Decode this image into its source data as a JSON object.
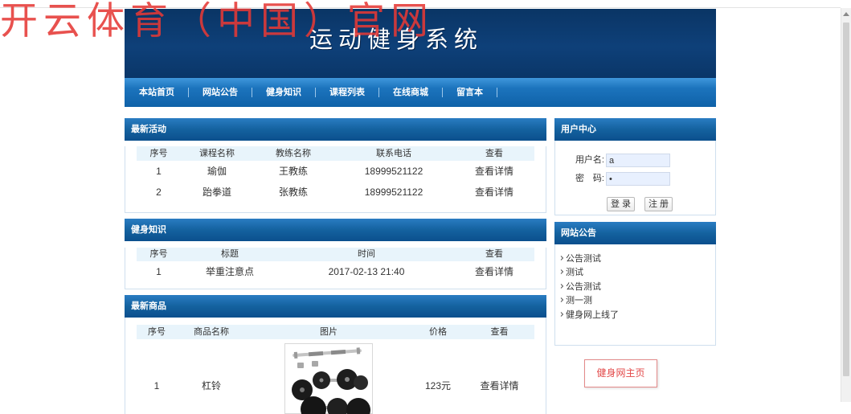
{
  "watermark": {
    "text": "开云体育（中国）官网"
  },
  "site": {
    "title": "运动健身系统"
  },
  "nav": [
    {
      "label": "本站首页"
    },
    {
      "label": "网站公告"
    },
    {
      "label": "健身知识"
    },
    {
      "label": "课程列表"
    },
    {
      "label": "在线商城"
    },
    {
      "label": "留言本"
    }
  ],
  "activities": {
    "title": "最新活动",
    "columns": [
      "序号",
      "课程名称",
      "教练名称",
      "联系电话",
      "查看"
    ],
    "rows": [
      [
        "1",
        "瑜伽",
        "王教练",
        "18999521122",
        "查看详情"
      ],
      [
        "2",
        "跆拳道",
        "张教练",
        "18999521122",
        "查看详情"
      ]
    ]
  },
  "knowledge": {
    "title": "健身知识",
    "columns": [
      "序号",
      "标题",
      "时间",
      "查看"
    ],
    "rows": [
      [
        "1",
        "举重注意点",
        "2017-02-13 21:40",
        "查看详情"
      ]
    ]
  },
  "products": {
    "title": "最新商品",
    "columns": [
      "序号",
      "商品名称",
      "图片",
      "价格",
      "查看"
    ],
    "rows": [
      {
        "no": "1",
        "name": "杠铃",
        "image": "barbell-product-image",
        "price": "123元",
        "link": "查看详情"
      }
    ]
  },
  "user_center": {
    "title": "用户中心",
    "username_label": "用户名:",
    "username_value": "a",
    "password_label": "密　码:",
    "password_value": "•",
    "login_label": "登 录",
    "register_label": "注 册"
  },
  "announcements": {
    "title": "网站公告",
    "items": [
      "公告测试",
      "测试",
      "公告测试",
      "测一测",
      "健身网上线了"
    ]
  },
  "home_link": {
    "label": "健身网主页"
  },
  "icons": {
    "announcement_bullet": "chevron-right-icon",
    "scroll_up": "scroll-up-arrow-icon"
  },
  "colors": {
    "header_bg": "#0c3a6f",
    "bar_blue": "#1a6db3",
    "table_head_bg": "#e8f4fb",
    "input_bg": "#e8f0fe",
    "watermark_red": "#e53935",
    "home_link_red": "#e34a4a"
  }
}
